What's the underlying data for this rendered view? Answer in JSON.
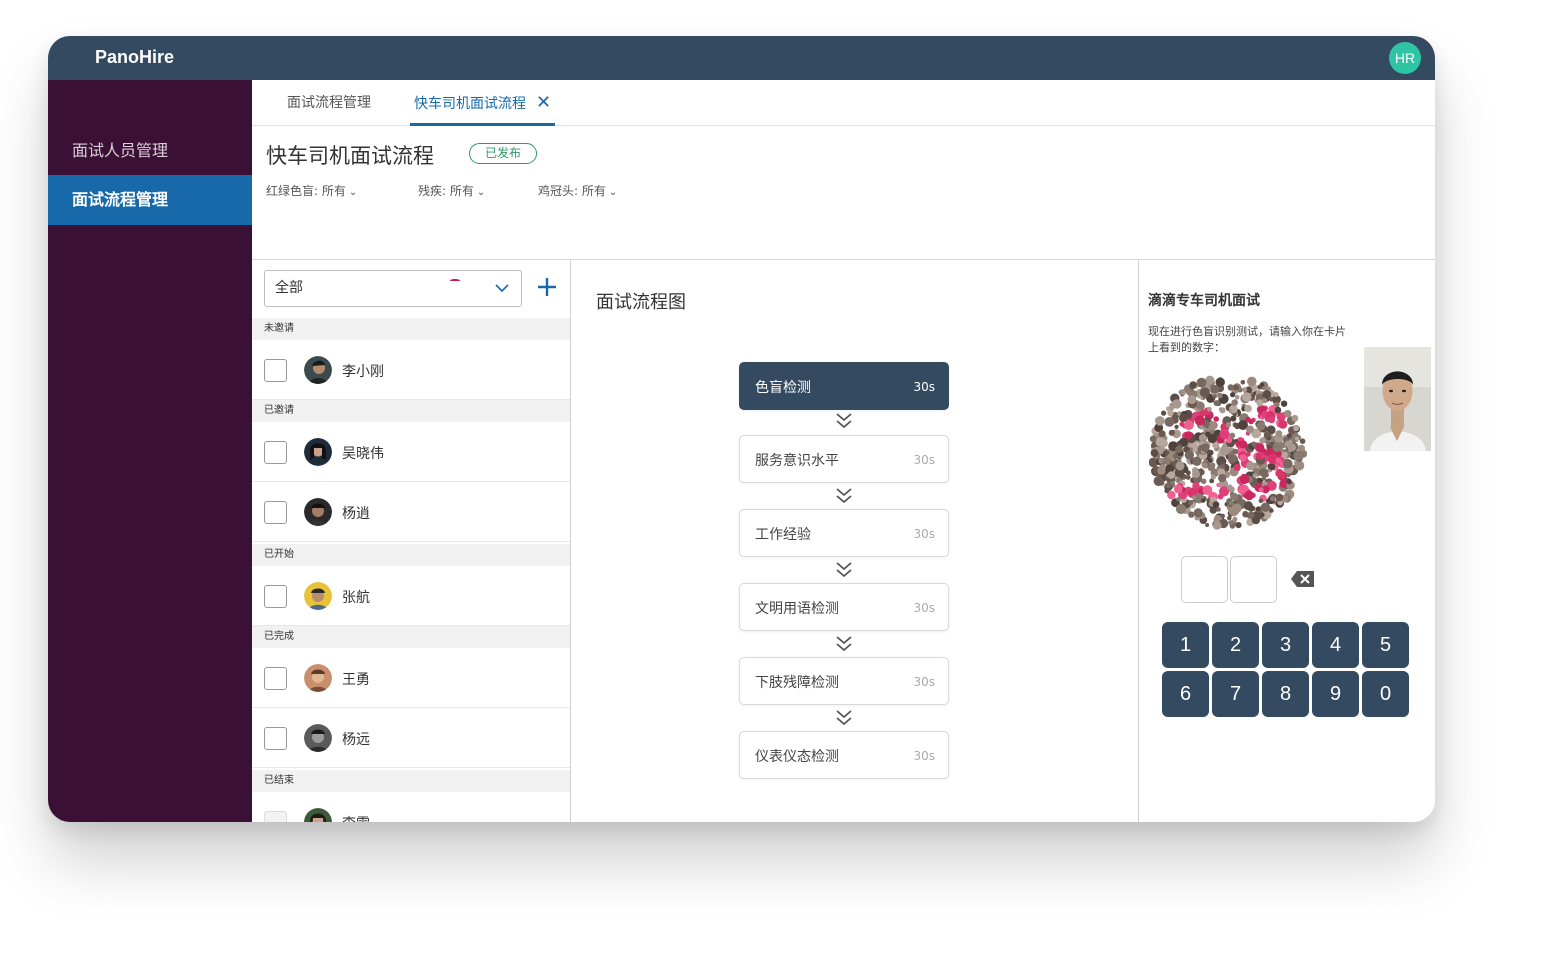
{
  "app": {
    "brand": "PanoHire",
    "user_initials": "HR"
  },
  "sidebar": {
    "items": [
      {
        "label": "面试人员管理"
      },
      {
        "label": "面试流程管理"
      }
    ]
  },
  "tabs": [
    {
      "label": "面试流程管理"
    },
    {
      "label": "快车司机面试流程"
    }
  ],
  "page": {
    "title": "快车司机面试流程",
    "status": "已发布",
    "filters": [
      {
        "label": "红绿色盲: 所有"
      },
      {
        "label": "残疾: 所有"
      },
      {
        "label": "鸡冠头: 所有"
      }
    ]
  },
  "candidates": {
    "filter_value": "全部",
    "groups": [
      {
        "label": "未邀请",
        "people": [
          {
            "name": "李小刚"
          }
        ]
      },
      {
        "label": "已邀请",
        "people": [
          {
            "name": "吴晓伟"
          },
          {
            "name": "杨逍"
          }
        ]
      },
      {
        "label": "已开始",
        "people": [
          {
            "name": "张航"
          }
        ]
      },
      {
        "label": "已完成",
        "people": [
          {
            "name": "王勇"
          },
          {
            "name": "杨远"
          }
        ]
      },
      {
        "label": "已结束",
        "people": [
          {
            "name": "李雪"
          }
        ]
      }
    ]
  },
  "flow": {
    "title": "面试流程图",
    "steps": [
      {
        "name": "色盲检测",
        "duration": "30s"
      },
      {
        "name": "服务意识水平",
        "duration": "30s"
      },
      {
        "name": "工作经验",
        "duration": "30s"
      },
      {
        "name": "文明用语检测",
        "duration": "30s"
      },
      {
        "name": "下肢残障检测",
        "duration": "30s"
      },
      {
        "name": "仪表仪态检测",
        "duration": "30s"
      }
    ]
  },
  "preview": {
    "title": "滴滴专车司机面试",
    "instruction_line1": "现在进行色盲识别测试，请输入你在卡片",
    "instruction_line2": "上看到的数字：",
    "keypad": [
      "1",
      "2",
      "3",
      "4",
      "5",
      "6",
      "7",
      "8",
      "9",
      "0"
    ]
  },
  "colors": {
    "topbar": "#344a60",
    "sidebar": "#3b1036",
    "accent": "#1769aa",
    "status_green": "#2e9a5f",
    "avatar_green": "#2ec4a4"
  }
}
